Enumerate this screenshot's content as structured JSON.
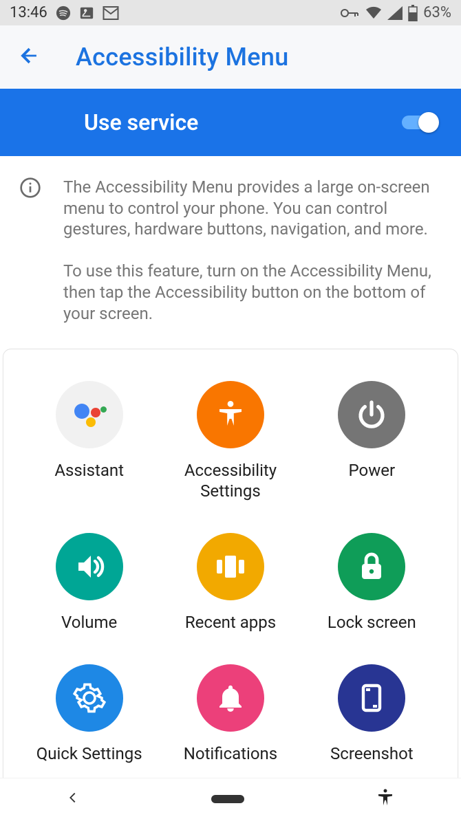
{
  "status": {
    "time": "13:46",
    "battery": "63%"
  },
  "header": {
    "title": "Accessibility Menu"
  },
  "service": {
    "label": "Use service",
    "enabled": true
  },
  "info": {
    "p1": "The Accessibility Menu provides a large on-screen menu to control your phone. You can control gestures, hardware buttons, navigation, and more.",
    "p2": "To use this feature, turn on the Accessibility Menu, then tap the Accessibility button on the bottom of your screen."
  },
  "tiles": {
    "assistant": "Assistant",
    "a11y_settings": "Accessibility\nSettings",
    "power": "Power",
    "volume": "Volume",
    "recent_apps": "Recent apps",
    "lock_screen": "Lock screen",
    "quick_settings": "Quick Settings",
    "notifications": "Notifications",
    "screenshot": "Screenshot"
  }
}
